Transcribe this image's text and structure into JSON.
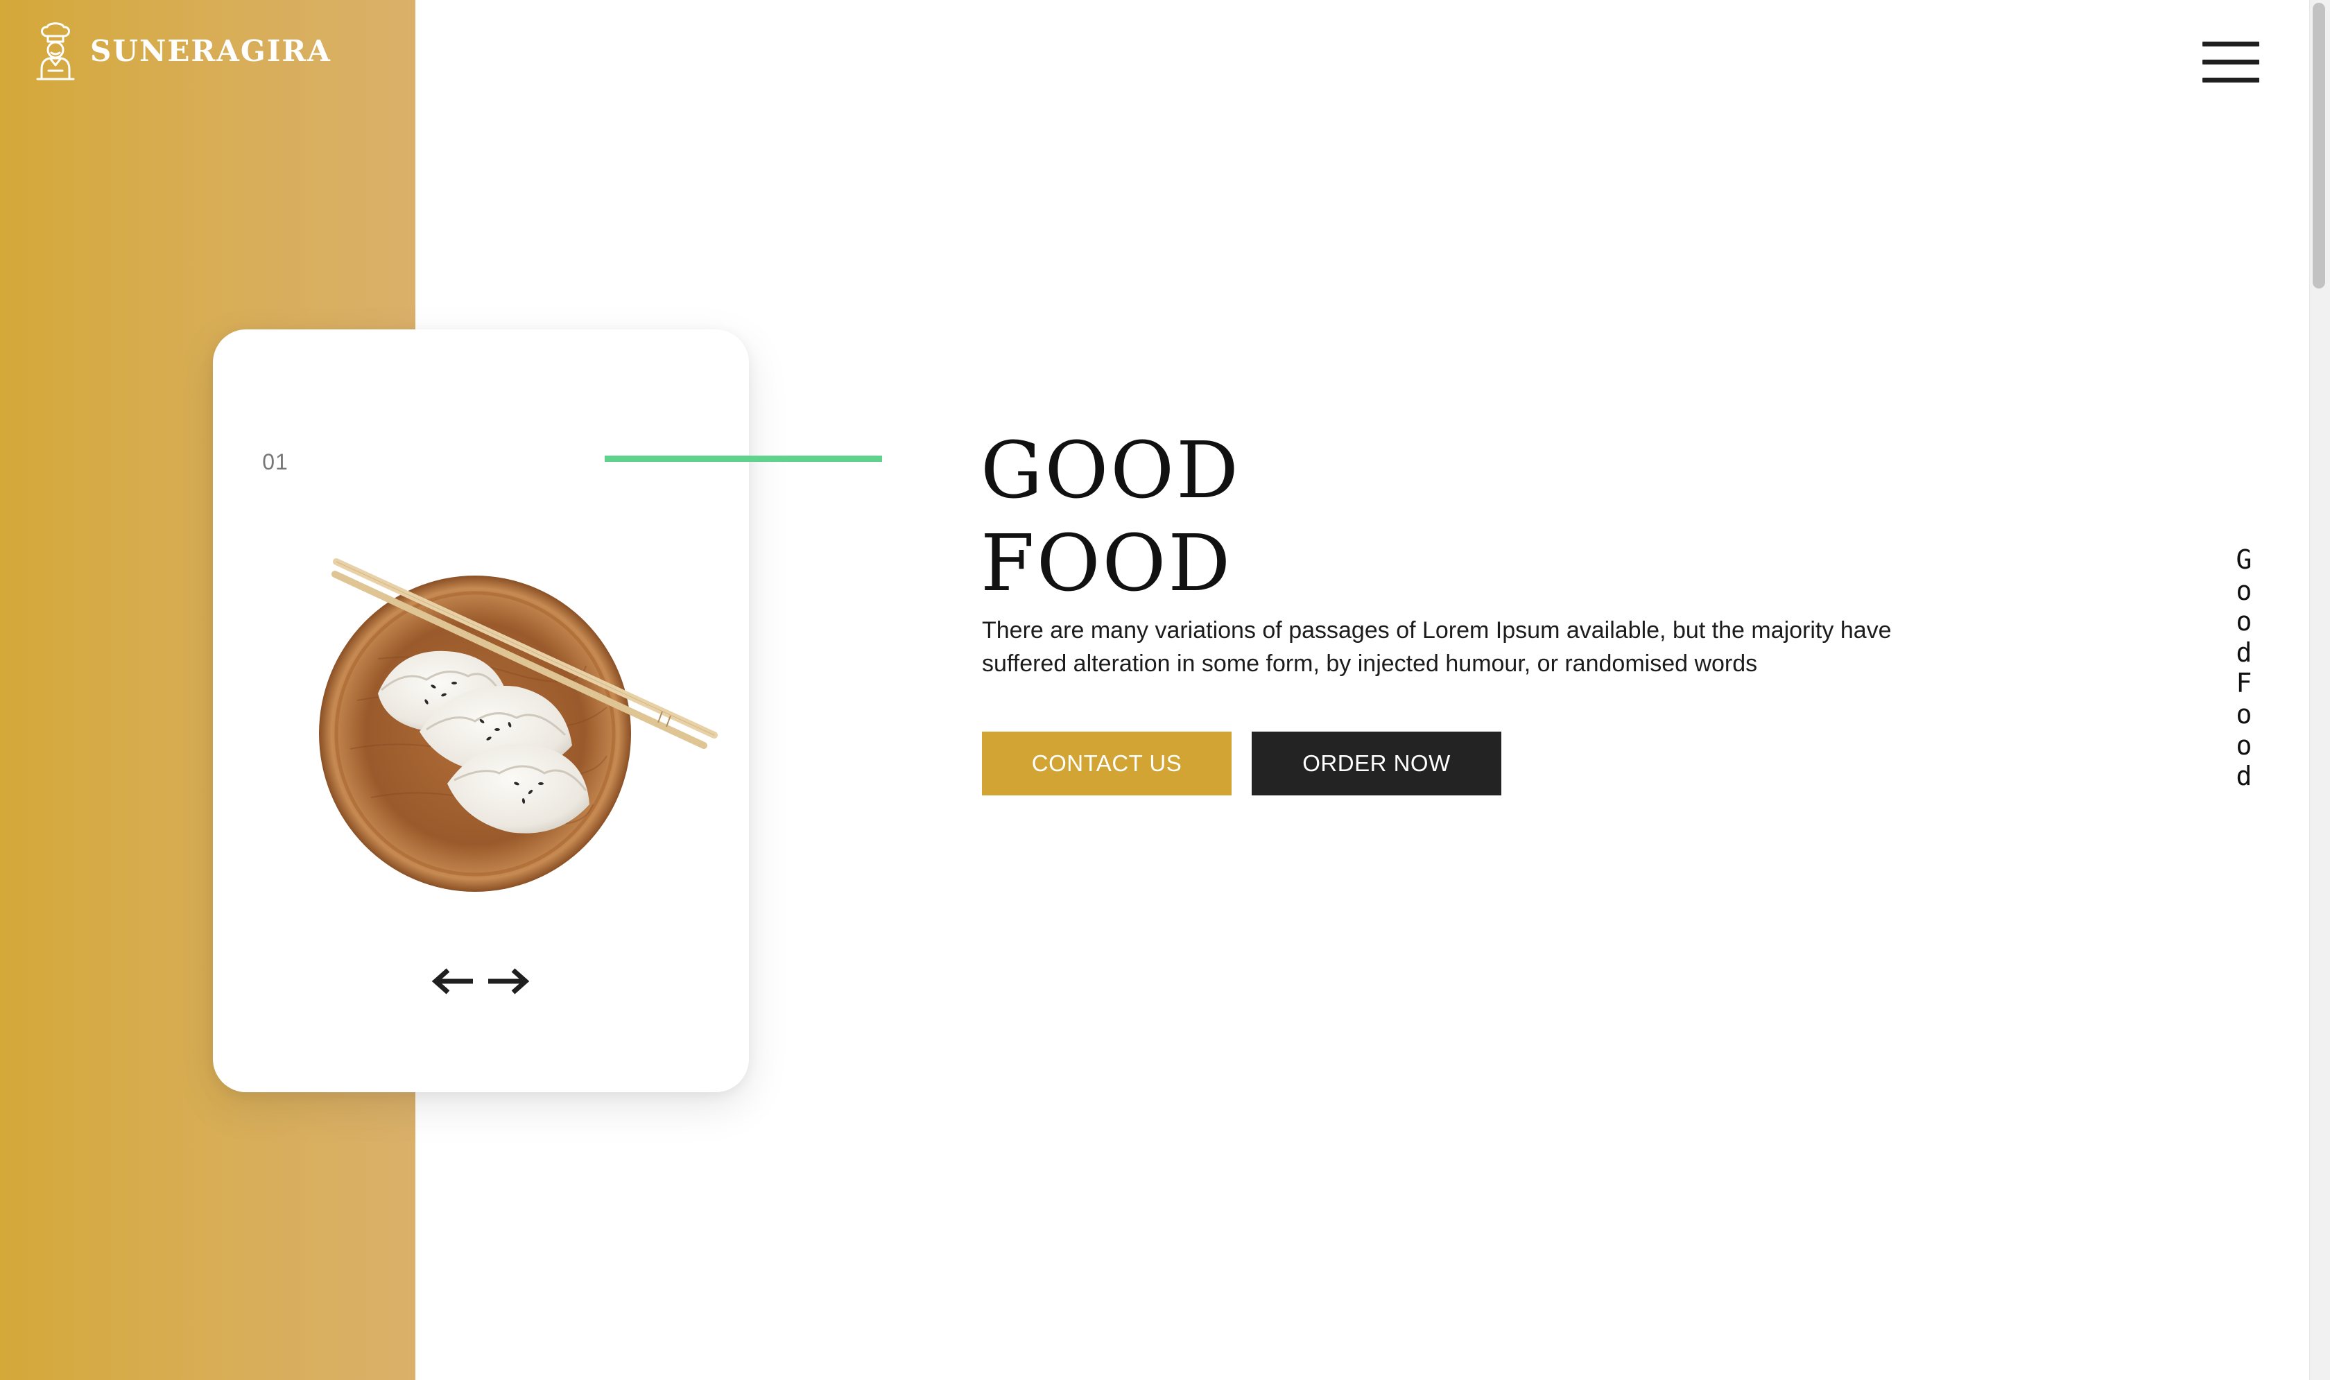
{
  "brand": {
    "name": "SUNERAGIRA",
    "logo_icon": "chef-icon"
  },
  "nav": {
    "menu_icon": "hamburger-menu-icon"
  },
  "slider": {
    "slide_number": "01",
    "image": "dumplings-on-wooden-plate-with-chopsticks",
    "prev_icon": "arrow-left-icon",
    "next_icon": "arrow-right-icon"
  },
  "hero": {
    "title_line1": "GOOD",
    "title_line2": "FOOD",
    "description": "There are many variations of passages of Lorem Ipsum available, but the majority have suffered alteration in some form, by injected humour, or randomised words",
    "contact_label": "CONTACT US",
    "order_label": "ORDER NOW"
  },
  "side_text": [
    "G",
    "o",
    "o",
    "d",
    "F",
    "o",
    "o",
    "d"
  ],
  "colors": {
    "accent_gold": "#d2a434",
    "dark": "#232323",
    "green_line": "#5fd38d"
  }
}
